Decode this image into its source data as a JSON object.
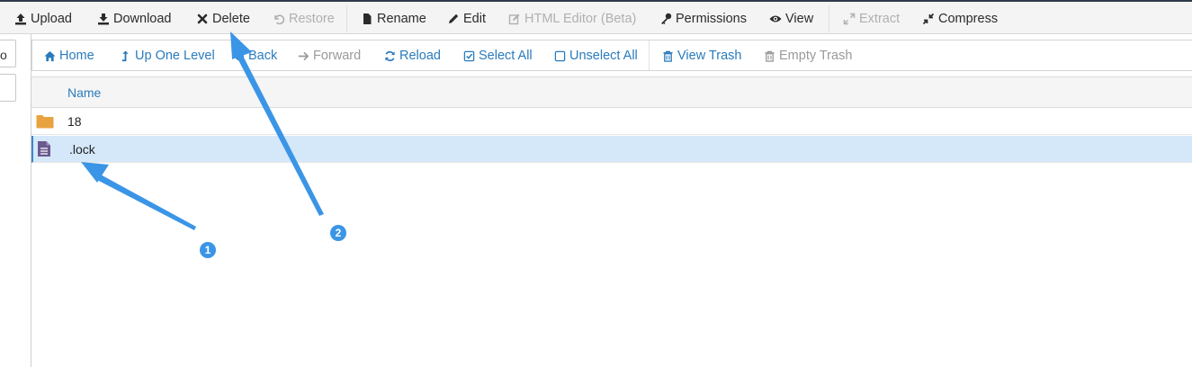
{
  "toolbar": {
    "upload": "Upload",
    "download": "Download",
    "delete": "Delete",
    "restore": "Restore",
    "rename": "Rename",
    "edit": "Edit",
    "html_editor": "HTML Editor (Beta)",
    "permissions": "Permissions",
    "view": "View",
    "extract": "Extract",
    "compress": "Compress"
  },
  "left_pane": {
    "go_label": "o"
  },
  "nav": {
    "home": "Home",
    "up_one_level": "Up One Level",
    "back": "Back",
    "forward": "Forward",
    "reload": "Reload",
    "select_all": "Select All",
    "unselect_all": "Unselect All",
    "view_trash": "View Trash",
    "empty_trash": "Empty Trash"
  },
  "table": {
    "header_name": "Name",
    "rows": [
      {
        "name": "18",
        "type": "folder",
        "selected": false
      },
      {
        "name": ".lock",
        "type": "file",
        "selected": true
      }
    ]
  },
  "annotations": {
    "badge_1": "1",
    "badge_2": "2"
  },
  "colors": {
    "link_blue": "#2a7bbd",
    "folder": "#e8a340",
    "file": "#6b5a8e",
    "selected_row": "#d4e8fa",
    "annotation": "#3b95e6"
  }
}
